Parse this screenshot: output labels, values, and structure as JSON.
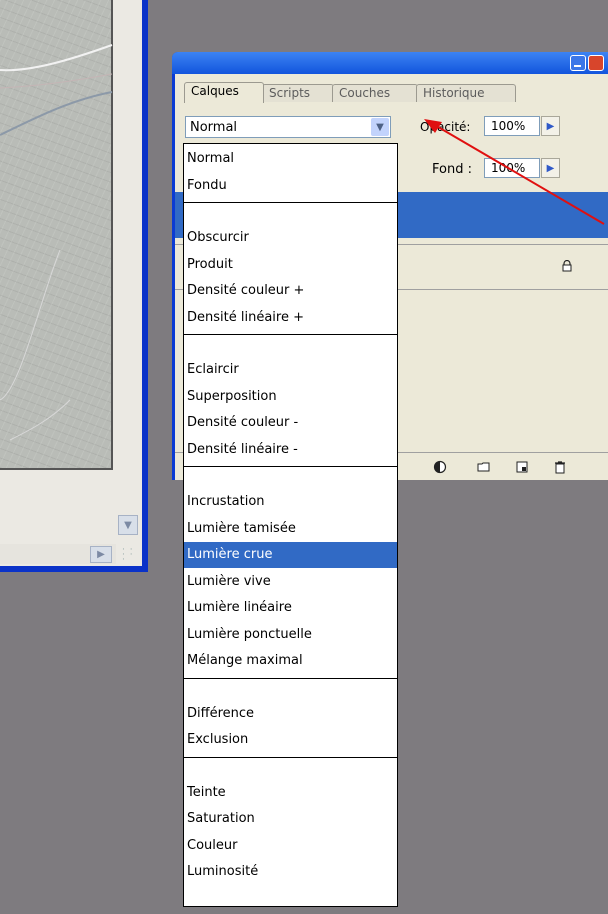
{
  "panel": {
    "tabs": [
      "Calques",
      "Scripts",
      "Couches",
      "Historique"
    ],
    "active_tab": "Calques",
    "blend_mode": "Normal",
    "opacity_label": "Opacité:",
    "opacity_value": "100%",
    "fill_label": "Fond :",
    "fill_value": "100%"
  },
  "blend_menu": {
    "groups": [
      [
        "Normal",
        "Fondu"
      ],
      [
        "Obscurcir",
        "Produit",
        "Densité couleur +",
        "Densité linéaire +"
      ],
      [
        "Eclaircir",
        "Superposition",
        "Densité couleur -",
        "Densité linéaire -"
      ],
      [
        "Incrustation",
        "Lumière tamisée",
        "Lumière crue",
        "Lumière vive",
        "Lumière linéaire",
        "Lumière ponctuelle",
        "Mélange maximal"
      ],
      [
        "Différence",
        "Exclusion"
      ],
      [
        "Teinte",
        "Saturation",
        "Couleur",
        "Luminosité"
      ]
    ],
    "highlighted": "Lumière crue"
  },
  "colors": {
    "selection": "#316ac5",
    "titlebar": "#1255dd",
    "arrow": "#e01010",
    "background": "#7e7b7f"
  }
}
